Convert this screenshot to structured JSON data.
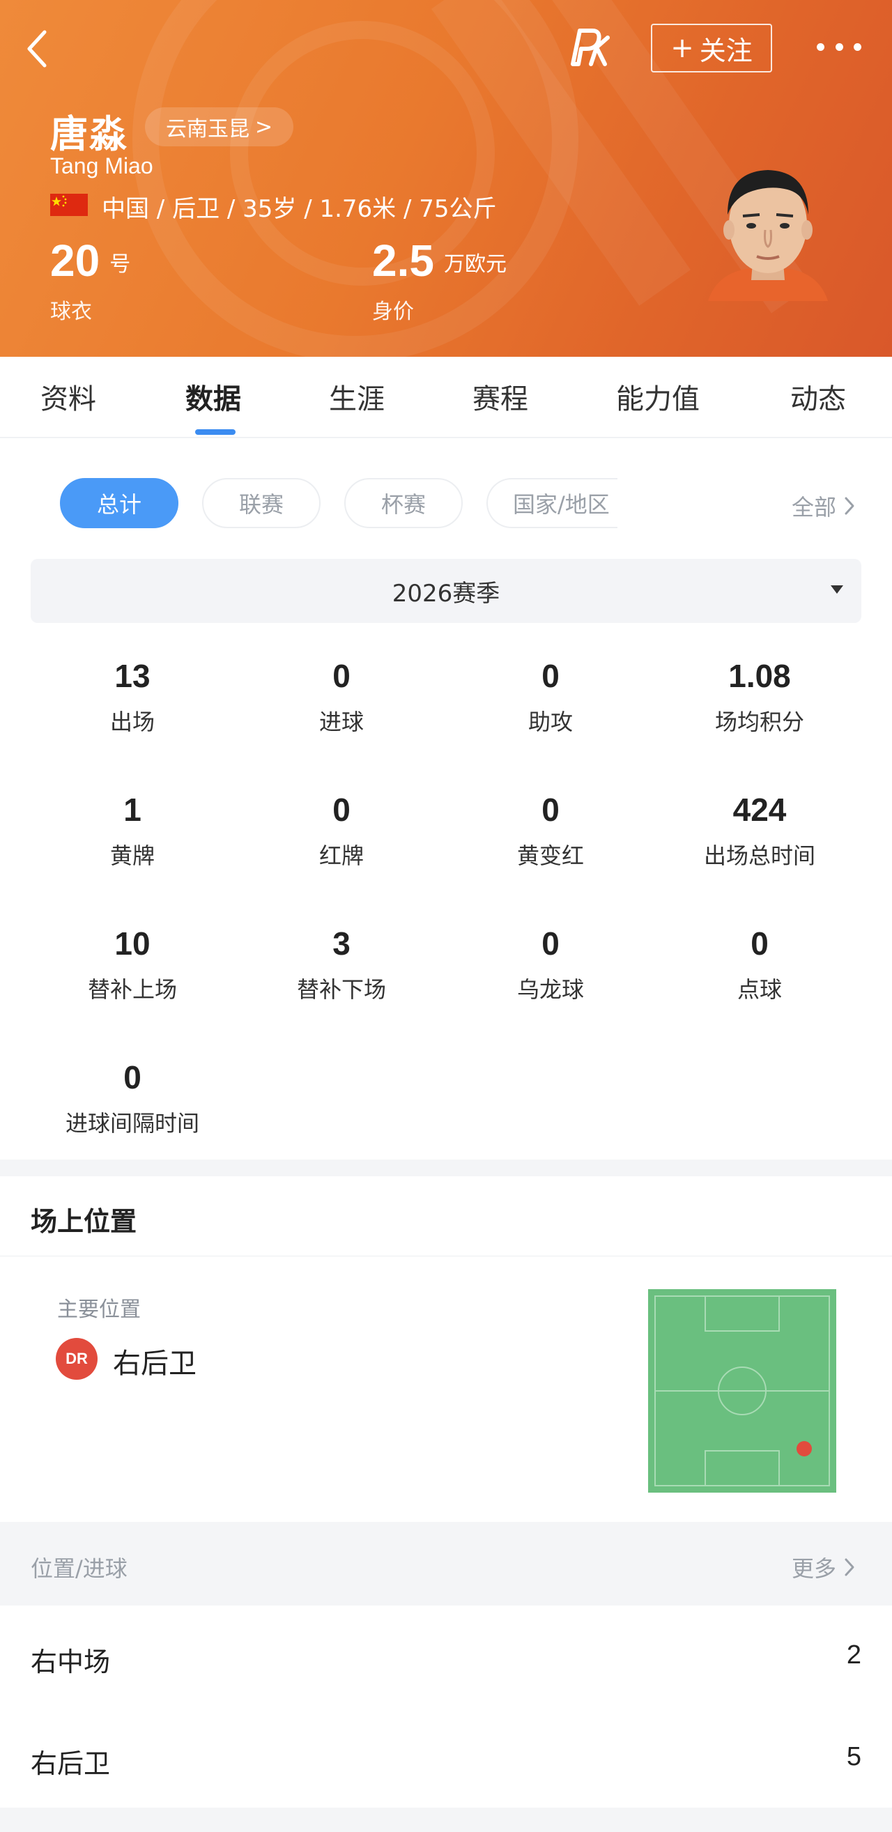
{
  "header": {
    "follow_label": "关注",
    "player_name": "唐淼",
    "team": "云南玉昆",
    "team_suffix": ">",
    "english_name": "Tang Miao",
    "info_line": "中国 / 后卫 / 35岁 / 1.76米 / 75公斤",
    "jersey_number": "20",
    "jersey_unit": "号",
    "jersey_label": "球衣",
    "market_value": "2.5",
    "market_value_unit": "万欧元",
    "market_value_label": "身价",
    "colors": {
      "gradient_start": "#ef8a3a",
      "gradient_end": "#d9582a"
    }
  },
  "tabs": [
    {
      "label": "资料"
    },
    {
      "label": "数据",
      "active": true
    },
    {
      "label": "生涯"
    },
    {
      "label": "赛程"
    },
    {
      "label": "能力值"
    },
    {
      "label": "动态"
    }
  ],
  "filters": {
    "pills": [
      {
        "label": "总计",
        "active": true
      },
      {
        "label": "联赛"
      },
      {
        "label": "杯赛"
      },
      {
        "label": "国家/地区"
      }
    ],
    "all_label": "全部"
  },
  "season": {
    "selected": "2026赛季"
  },
  "stats": [
    {
      "value": "13",
      "label": "出场"
    },
    {
      "value": "0",
      "label": "进球"
    },
    {
      "value": "0",
      "label": "助攻"
    },
    {
      "value": "1.08",
      "label": "场均积分"
    },
    {
      "value": "1",
      "label": "黄牌"
    },
    {
      "value": "0",
      "label": "红牌"
    },
    {
      "value": "0",
      "label": "黄变红"
    },
    {
      "value": "424",
      "label": "出场总时间"
    },
    {
      "value": "10",
      "label": "替补上场"
    },
    {
      "value": "3",
      "label": "替补下场"
    },
    {
      "value": "0",
      "label": "乌龙球"
    },
    {
      "value": "0",
      "label": "点球"
    },
    {
      "value": "0",
      "label": "进球间隔时间"
    }
  ],
  "position": {
    "section_title": "场上位置",
    "main_label": "主要位置",
    "badge": "DR",
    "name": "右后卫",
    "pitch_color": "#6abf7f",
    "marker_color": "#e24b3d"
  },
  "position_goals": {
    "header_left": "位置/进球",
    "header_right": "更多",
    "rows": [
      {
        "name": "右中场",
        "count": "2"
      },
      {
        "name": "右后卫",
        "count": "5"
      }
    ]
  },
  "icons": [
    "back-icon",
    "pk-logo-icon",
    "plus-icon",
    "more-icon",
    "china-flag-icon",
    "chevron-right-icon",
    "caret-down-icon"
  ]
}
